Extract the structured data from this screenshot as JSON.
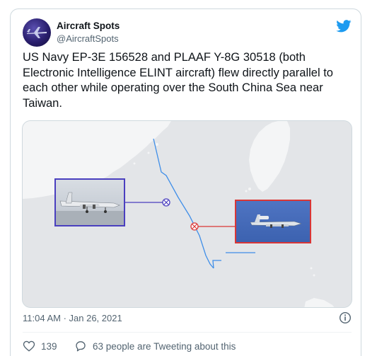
{
  "author": {
    "name": "Aircraft Spots",
    "handle": "@AircraftSpots"
  },
  "tweet": {
    "text": "US Navy EP-3E 156528 and PLAAF Y-8G 30518 (both Electronic Intelligence ELINT aircraft) flew directly parallel to each other while operating over the South China Sea near Taiwan."
  },
  "meta": {
    "timestamp": "11:04 AM · Jan 26, 2021"
  },
  "actions": {
    "likes": "139",
    "conversation": "63 people are Tweeting about this"
  },
  "icons": {
    "brand": "twitter-bird-icon",
    "info": "info-icon",
    "like": "heart-icon",
    "reply": "speech-bubble-icon"
  },
  "colors": {
    "twitter_blue": "#1d9bf0",
    "ep3_track": "#4a3fbf",
    "y8_track": "#d93636",
    "flight_path": "#3f8ee8"
  }
}
